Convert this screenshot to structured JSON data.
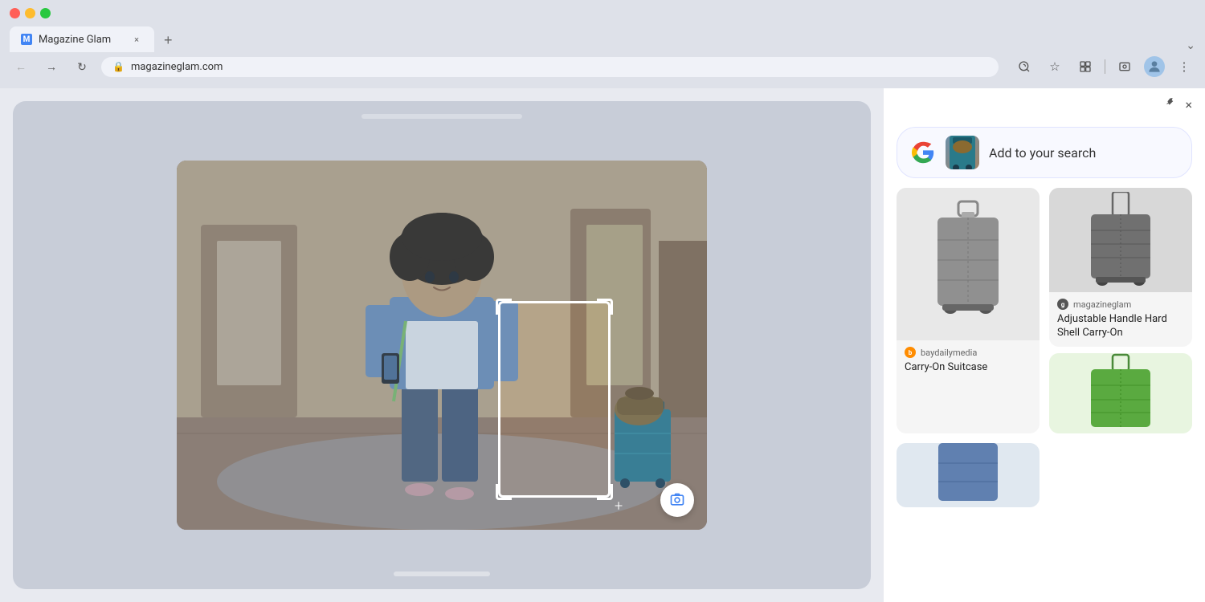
{
  "browser": {
    "tab_title": "Magazine Glam",
    "url": "magazineglam.com",
    "tab_close": "×",
    "tab_new": "+",
    "tab_dropdown": "⌄"
  },
  "toolbar": {
    "back": "←",
    "forward": "→",
    "refresh": "↻",
    "lens_icon": "⊙",
    "star_icon": "☆",
    "extensions_icon": "⬡",
    "screenshot_icon": "⊡",
    "profile_icon": "👤",
    "menu_icon": "⋮",
    "pin_icon": "📌",
    "close_icon": "×"
  },
  "lens_panel": {
    "search_prompt": "Add to your search",
    "google_letter": "G",
    "results": [
      {
        "id": "result-1",
        "source": "baydailymedia",
        "title": "Carry-On Suitcase",
        "color": "gray",
        "source_type": "baydaily"
      },
      {
        "id": "result-2",
        "source": "magazineglam",
        "title": "Adjustable Handle Hard Shell Carry-On",
        "color": "dark-gray",
        "source_type": "magazineglam"
      },
      {
        "id": "result-3",
        "source": "",
        "title": "",
        "color": "green",
        "source_type": ""
      }
    ]
  }
}
